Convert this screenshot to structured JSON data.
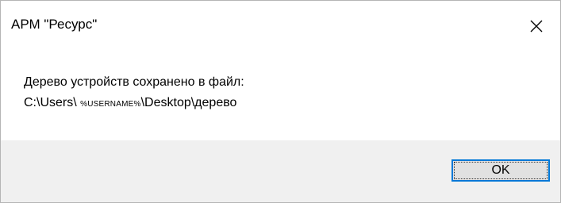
{
  "dialog": {
    "title": "АРМ \"Ресурс\"",
    "message_line1": "Дерево устройств сохранено в файл:",
    "message_line2_prefix": "C:\\Users\\ ",
    "message_line2_var": "%USERNAME%",
    "message_line2_suffix": "\\Desktop\\дерево",
    "ok_label": "OK",
    "close_icon": "close-icon"
  },
  "colors": {
    "footer_bg": "#f0f0f0",
    "accent_border": "#0078d7",
    "button_bg": "#e1e1e1"
  }
}
